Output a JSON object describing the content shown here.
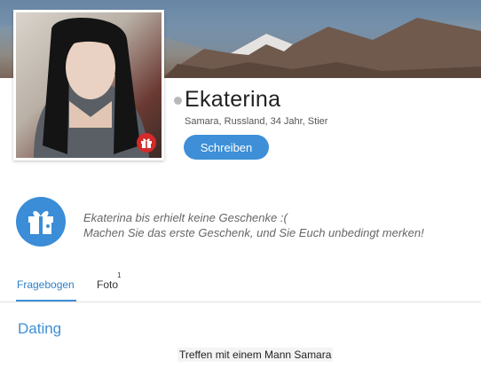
{
  "profile": {
    "name": "Ekaterina",
    "info": "Samara, Russland, 34 Jahr, Stier",
    "write_button": "Schreiben"
  },
  "gifts": {
    "line1": "Ekaterina bis erhielt keine Geschenke :(",
    "line2": "Machen Sie das erste Geschenk, und Sie Euch unbedingt merken!"
  },
  "tabs": [
    {
      "label": "Fragebogen",
      "active": true
    },
    {
      "label": "Foto",
      "count": "1",
      "active": false
    }
  ],
  "section": {
    "title": "Dating",
    "items": [
      "Treffen mit einem Mann Samara"
    ]
  },
  "icons": {
    "avatar_badge": "gift-icon",
    "gifts_circle": "gift-icon",
    "status": "offline-status-dot"
  },
  "colors": {
    "accent": "#3e8fd8",
    "badge": "#d42a2a",
    "status_dot": "#b8b8b8"
  }
}
